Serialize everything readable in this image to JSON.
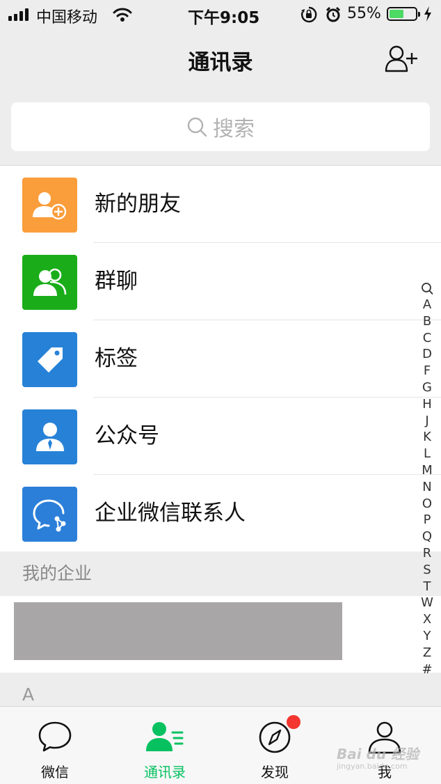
{
  "status_bar": {
    "carrier": "中国移动",
    "time": "下午9:05",
    "battery_percent": "55%",
    "battery_level": 0.55,
    "icons": [
      "signal-icon",
      "wifi-icon",
      "rotation-lock-icon",
      "alarm-icon",
      "battery-icon",
      "charging-icon"
    ]
  },
  "nav": {
    "title": "通讯录",
    "add_icon": "add-contact-icon"
  },
  "search": {
    "placeholder": "搜索",
    "icon": "search-icon"
  },
  "menu": [
    {
      "label": "新的朋友",
      "icon": "new-friends-icon",
      "color": "#fa9d3b"
    },
    {
      "label": "群聊",
      "icon": "group-chat-icon",
      "color": "#1aad19"
    },
    {
      "label": "标签",
      "icon": "tag-icon",
      "color": "#2782d7"
    },
    {
      "label": "公众号",
      "icon": "official-account-icon",
      "color": "#2782d7"
    },
    {
      "label": "企业微信联系人",
      "icon": "wecom-icon",
      "color": "#2b7fd9"
    }
  ],
  "sections": {
    "enterprise": "我的企业",
    "a": "A"
  },
  "index": [
    "A",
    "B",
    "C",
    "D",
    "F",
    "G",
    "H",
    "J",
    "K",
    "L",
    "M",
    "N",
    "O",
    "P",
    "Q",
    "R",
    "S",
    "T",
    "W",
    "X",
    "Y",
    "Z",
    "#"
  ],
  "tabs": [
    {
      "label": "微信",
      "icon": "chat-bubble-icon",
      "active": false
    },
    {
      "label": "通讯录",
      "icon": "contacts-icon",
      "active": true
    },
    {
      "label": "发现",
      "icon": "compass-icon",
      "active": false,
      "badge": true
    },
    {
      "label": "我",
      "icon": "me-icon",
      "active": false
    }
  ],
  "colors": {
    "accent": "#07c160",
    "badge": "#f43530",
    "background": "#ededed"
  },
  "watermark": {
    "text": "Bai du 经验",
    "url_text": "jingyan.baidu.com"
  }
}
